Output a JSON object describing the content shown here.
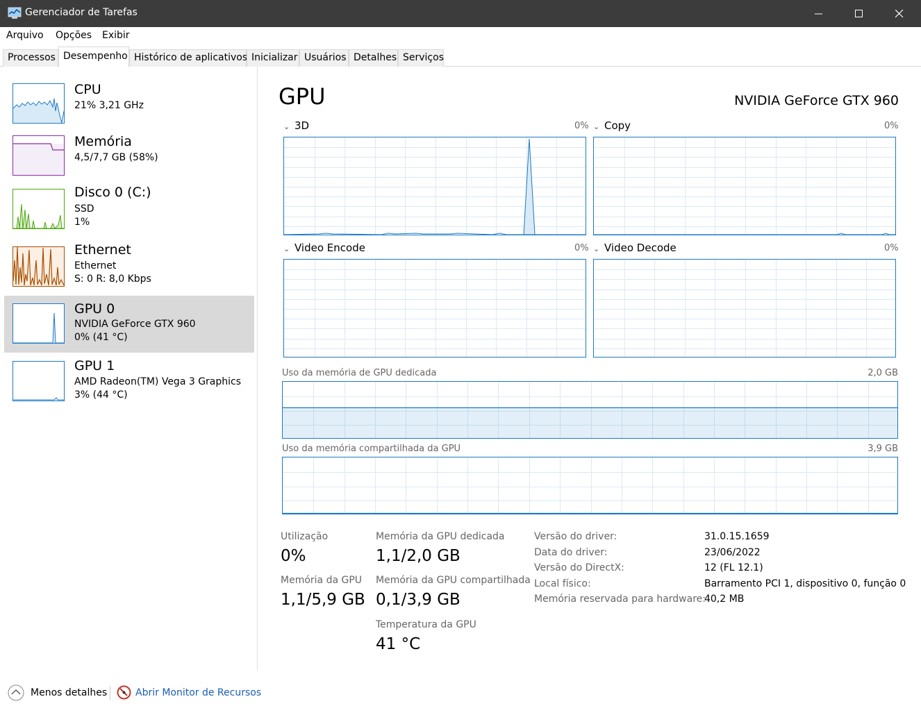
{
  "window": {
    "title": "Gerenciador de Tarefas"
  },
  "menu": [
    "Arquivo",
    "Opções",
    "Exibir"
  ],
  "tabs": [
    "Processos",
    "Desempenho",
    "Histórico de aplicativos",
    "Inicializar",
    "Usuários",
    "Detalhes",
    "Serviços"
  ],
  "active_tab": "Desempenho",
  "sidebar": [
    {
      "title": "CPU",
      "line2": "21% 3,21 GHz",
      "line3": "",
      "color": "#1a79c6"
    },
    {
      "title": "Memória",
      "line2": "4,5/7,7 GB (58%)",
      "line3": "",
      "color": "#8b2ba8"
    },
    {
      "title": "Disco 0 (C:)",
      "line2": "SSD",
      "line3": "1%",
      "color": "#4da60c"
    },
    {
      "title": "Ethernet",
      "line2": "Ethernet",
      "line3": "S: 0 R: 8,0 Kbps",
      "color": "#a74f01"
    },
    {
      "title": "GPU 0",
      "line2": "NVIDIA GeForce GTX 960",
      "line3": "0% (41 °C)",
      "color": "#1a79c6",
      "selected": true
    },
    {
      "title": "GPU 1",
      "line2": "AMD Radeon(TM) Vega 3 Graphics",
      "line3": "3% (44 °C)",
      "color": "#1a79c6"
    }
  ],
  "main": {
    "title": "GPU",
    "device": "NVIDIA GeForce GTX 960",
    "engines": [
      {
        "name": "3D",
        "pct": "0%"
      },
      {
        "name": "Copy",
        "pct": "0%"
      },
      {
        "name": "Video Encode",
        "pct": "0%"
      },
      {
        "name": "Video Decode",
        "pct": "0%"
      }
    ],
    "dedicated_mem": {
      "label": "Uso da memória de GPU dedicada",
      "max": "2,0 GB",
      "level": 0.55
    },
    "shared_mem": {
      "label": "Uso da memória compartilhada da GPU",
      "max": "3,9 GB",
      "level": 0.03
    }
  },
  "stats": {
    "utilizacao_label": "Utilização",
    "utilizacao": "0%",
    "mem_gpu_label": "Memória da GPU",
    "mem_gpu": "1,1/5,9 GB",
    "dedicada_label": "Memória da GPU dedicada",
    "dedicada": "1,1/2,0 GB",
    "compartilhada_label": "Memória da GPU compartilhada",
    "compartilhada": "0,1/3,9 GB",
    "temp_label": "Temperatura da GPU",
    "temp": "41 °C"
  },
  "info": [
    {
      "label": "Versão do driver:",
      "value": "31.0.15.1659"
    },
    {
      "label": "Data do driver:",
      "value": "23/06/2022"
    },
    {
      "label": "Versão do DirectX:",
      "value": "12 (FL 12.1)"
    },
    {
      "label": "Local físico:",
      "value": "Barramento PCI 1, dispositivo 0, função 0"
    },
    {
      "label": "Memória reservada para hardware:",
      "value": "40,2 MB"
    }
  ],
  "footer": {
    "less_details": "Menos detalhes",
    "resource_monitor": "Abrir Monitor de Recursos"
  }
}
